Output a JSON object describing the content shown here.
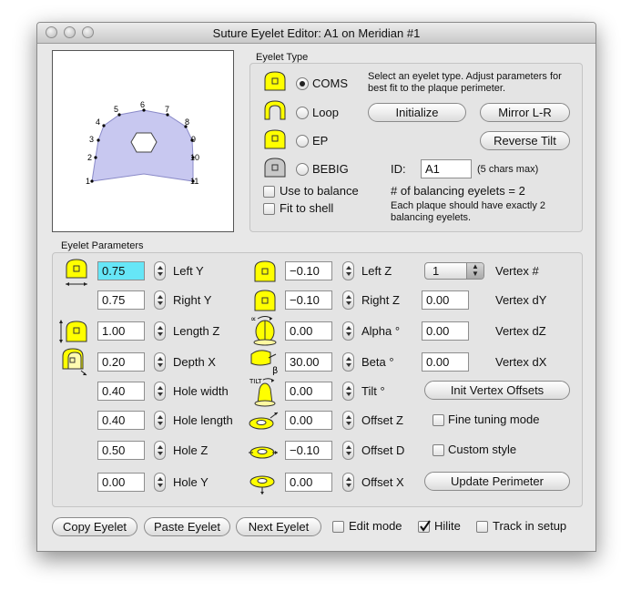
{
  "window": {
    "title": "Suture Eyelet Editor: A1 on Meridian #1"
  },
  "preview": {
    "vertex_labels": [
      "1",
      "2",
      "3",
      "4",
      "5",
      "6",
      "7",
      "8",
      "9",
      "10",
      "11"
    ]
  },
  "eyelet_type": {
    "group_label": "Eyelet Type",
    "options": [
      "COMS",
      "Loop",
      "EP",
      "BEBIG"
    ],
    "selected": "COMS",
    "instructions": "Select an eyelet type. Adjust parameters for best fit to the plaque perimeter.",
    "initialize_label": "Initialize",
    "mirror_label": "Mirror L-R",
    "reverse_tilt_label": "Reverse Tilt",
    "id_label": "ID:",
    "id_value": "A1",
    "id_hint": "(5 chars max)",
    "use_to_balance": "Use to balance",
    "fit_to_shell": "Fit to shell",
    "balancing_count": "# of balancing eyelets = 2",
    "balancing_note": "Each plaque should have exactly 2 balancing eyelets."
  },
  "params": {
    "group_label": "Eyelet Parameters",
    "col1": [
      {
        "label": "Left Y",
        "value": "0.75"
      },
      {
        "label": "Right Y",
        "value": "0.75"
      },
      {
        "label": "Length Z",
        "value": "1.00"
      },
      {
        "label": "Depth X",
        "value": "0.20"
      },
      {
        "label": "Hole width",
        "value": "0.40"
      },
      {
        "label": "Hole length",
        "value": "0.40"
      },
      {
        "label": "Hole Z",
        "value": "0.50"
      },
      {
        "label": "Hole Y",
        "value": "0.00"
      }
    ],
    "col2": [
      {
        "label": "Left Z",
        "value": "−0.10"
      },
      {
        "label": "Right Z",
        "value": "−0.10"
      },
      {
        "label": "Alpha °",
        "value": "0.00"
      },
      {
        "label": "Beta °",
        "value": "30.00"
      },
      {
        "label": "Tilt °",
        "value": "0.00"
      },
      {
        "label": "Offset Z",
        "value": "0.00"
      },
      {
        "label": "Offset D",
        "value": "−0.10"
      },
      {
        "label": "Offset X",
        "value": "0.00"
      }
    ],
    "vertex": {
      "select_value": "1",
      "select_label": "Vertex #",
      "dy_value": "0.00",
      "dy_label": "Vertex dY",
      "dz_value": "0.00",
      "dz_label": "Vertex dZ",
      "dx_value": "0.00",
      "dx_label": "Vertex dX"
    },
    "init_vertex_offsets": "Init Vertex Offsets",
    "fine_tuning": "Fine tuning mode",
    "custom_style": "Custom style",
    "update_perimeter": "Update Perimeter",
    "icon_text": {
      "alpha": "∝",
      "beta": "β",
      "tilt": "TILT"
    }
  },
  "bottom": {
    "copy": "Copy Eyelet",
    "paste": "Paste Eyelet",
    "next": "Next Eyelet",
    "edit_mode": "Edit mode",
    "hilite": "Hilite",
    "track": "Track in setup"
  },
  "colors": {
    "eyelet_yellow": "#ffff00",
    "shape_fill": "#c8c8f0",
    "selected_field": "#66e6f7"
  }
}
